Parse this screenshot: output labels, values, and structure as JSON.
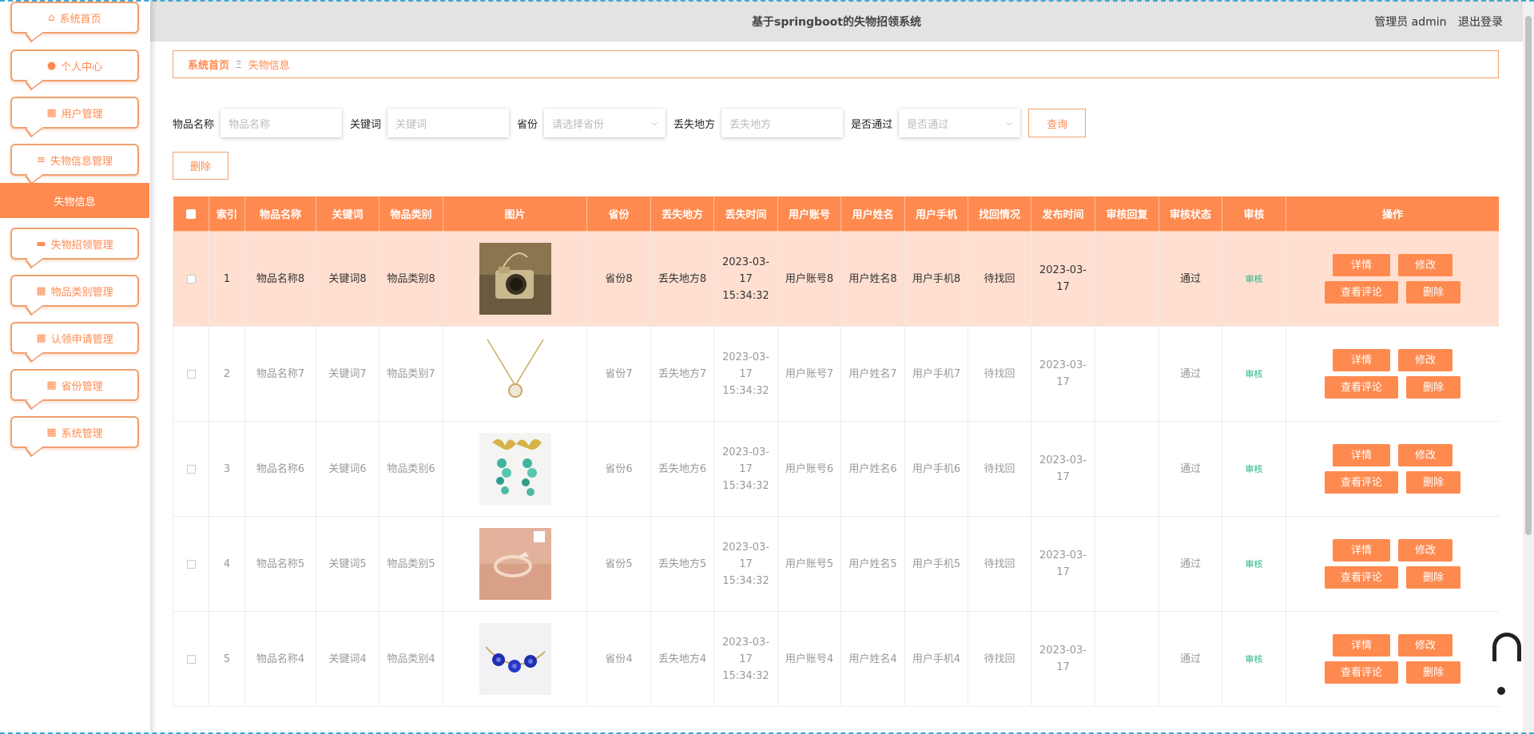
{
  "app": {
    "title": "基于springboot的失物招领系统"
  },
  "header": {
    "role_user": "管理员 admin",
    "logout": "退出登录"
  },
  "sidebar": {
    "items": [
      {
        "label": "系统首页",
        "icon": "home-icon",
        "glyph": "⌂"
      },
      {
        "label": "个人中心",
        "icon": "user-icon",
        "glyph": "●"
      },
      {
        "label": "用户管理",
        "icon": "grid-icon",
        "glyph": "▦"
      },
      {
        "label": "失物信息管理",
        "icon": "list-icon",
        "glyph": "≡"
      },
      {
        "label": "失物招领管理",
        "icon": "briefcase-icon",
        "glyph": "▬"
      },
      {
        "label": "物品类别管理",
        "icon": "grid-icon",
        "glyph": "▦"
      },
      {
        "label": "认领申请管理",
        "icon": "grid-icon",
        "glyph": "▦"
      },
      {
        "label": "省份管理",
        "icon": "grid-icon",
        "glyph": "▦"
      },
      {
        "label": "系统管理",
        "icon": "grid-icon",
        "glyph": "▦"
      }
    ],
    "active_sub": "失物信息"
  },
  "breadcrumb": {
    "home": "系统首页",
    "sep": "Ξ",
    "current": "失物信息"
  },
  "search": {
    "name_label": "物品名称",
    "name_placeholder": "物品名称",
    "keyword_label": "关键词",
    "keyword_placeholder": "关键词",
    "province_label": "省份",
    "province_placeholder": "请选择省份",
    "place_label": "丢失地方",
    "place_placeholder": "丢失地方",
    "pass_label": "是否通过",
    "pass_placeholder": "是否通过",
    "query_button": "查询"
  },
  "delete_button": "删除",
  "table": {
    "columns": [
      "索引",
      "物品名称",
      "关键词",
      "物品类别",
      "图片",
      "省份",
      "丢失地方",
      "丢失时间",
      "用户账号",
      "用户姓名",
      "用户手机",
      "找回情况",
      "发布时间",
      "审核回复",
      "审核状态",
      "审核",
      "操作"
    ],
    "rows": [
      {
        "index": "1",
        "name": "物品名称8",
        "keyword": "关键词8",
        "category": "物品类别8",
        "image": "camera-pendant-photo",
        "province": "省份8",
        "place": "丢失地方8",
        "lost_time": "2023-03-17 15:34:32",
        "account": "用户账号8",
        "username": "用户姓名8",
        "phone": "用户手机8",
        "found": "待找回",
        "publish": "2023-03-17",
        "reply": "",
        "status": "通过",
        "audit": "审核"
      },
      {
        "index": "2",
        "name": "物品名称7",
        "keyword": "关键词7",
        "category": "物品类别7",
        "image": "necklace-photo",
        "province": "省份7",
        "place": "丢失地方7",
        "lost_time": "2023-03-17 15:34:32",
        "account": "用户账号7",
        "username": "用户姓名7",
        "phone": "用户手机7",
        "found": "待找回",
        "publish": "2023-03-17",
        "reply": "",
        "status": "通过",
        "audit": "审核"
      },
      {
        "index": "3",
        "name": "物品名称6",
        "keyword": "关键词6",
        "category": "物品类别6",
        "image": "butterfly-earrings-photo",
        "province": "省份6",
        "place": "丢失地方6",
        "lost_time": "2023-03-17 15:34:32",
        "account": "用户账号6",
        "username": "用户姓名6",
        "phone": "用户手机6",
        "found": "待找回",
        "publish": "2023-03-17",
        "reply": "",
        "status": "通过",
        "audit": "审核"
      },
      {
        "index": "4",
        "name": "物品名称5",
        "keyword": "关键词5",
        "category": "物品类别5",
        "image": "ring-photo",
        "province": "省份5",
        "place": "丢失地方5",
        "lost_time": "2023-03-17 15:34:32",
        "account": "用户账号5",
        "username": "用户姓名5",
        "phone": "用户手机5",
        "found": "待找回",
        "publish": "2023-03-17",
        "reply": "",
        "status": "通过",
        "audit": "审核"
      },
      {
        "index": "5",
        "name": "物品名称4",
        "keyword": "关键词4",
        "category": "物品类别4",
        "image": "bracelet-photo",
        "province": "省份4",
        "place": "丢失地方4",
        "lost_time": "2023-03-17 15:34:32",
        "account": "用户账号4",
        "username": "用户姓名4",
        "phone": "用户手机4",
        "found": "待找回",
        "publish": "2023-03-17",
        "reply": "",
        "status": "通过",
        "audit": "审核"
      }
    ],
    "actions": {
      "detail": "详情",
      "edit": "修改",
      "comments": "查看评论",
      "delete": "删除"
    }
  },
  "colors": {
    "accent": "#ff8a4f",
    "row_highlight": "#ffdfd0",
    "audit_link": "#26b38a",
    "header_bg": "#e3e3e3"
  }
}
